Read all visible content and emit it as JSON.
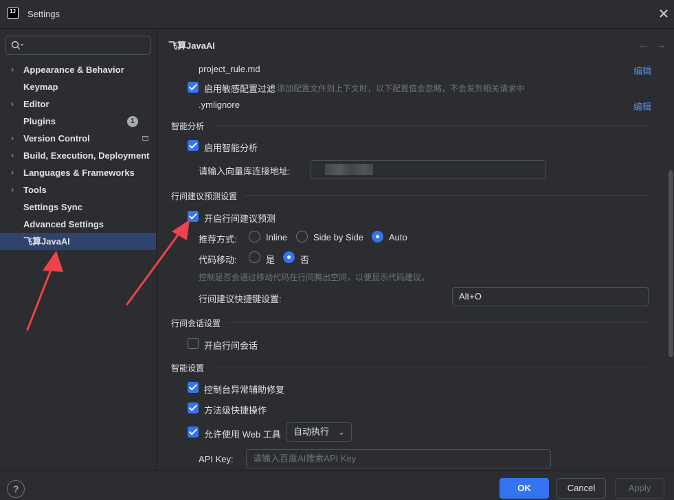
{
  "window": {
    "title": "Settings",
    "logo_text": "IJ",
    "close_icon": "close-icon"
  },
  "sidebar": {
    "search_placeholder": "",
    "items": [
      {
        "label": "Appearance & Behavior",
        "expandable": true
      },
      {
        "label": "Keymap",
        "expandable": false
      },
      {
        "label": "Editor",
        "expandable": true
      },
      {
        "label": "Plugins",
        "expandable": false,
        "badge": "1"
      },
      {
        "label": "Version Control",
        "expandable": true
      },
      {
        "label": "Build, Execution, Deployment",
        "expandable": true
      },
      {
        "label": "Languages & Frameworks",
        "expandable": true
      },
      {
        "label": "Tools",
        "expandable": true
      },
      {
        "label": "Settings Sync",
        "expandable": false
      },
      {
        "label": "Advanced Settings",
        "expandable": false
      },
      {
        "label": "飞算JavaAI",
        "expandable": false,
        "active": true
      }
    ]
  },
  "main": {
    "title": "飞算JavaAI",
    "rows": {
      "project_rule": {
        "label": "project_rule.md",
        "edit": "编辑"
      },
      "sensitive": {
        "label": "启用敏感配置过滤",
        "hint": "添加配置文件到上下文时，以下配置值会忽略，不会发到相关请求中",
        "checked": true
      },
      "ymlignore": {
        "label": ".ymlignore",
        "edit": "编辑"
      }
    },
    "smart_analysis": {
      "heading": "智能分析",
      "enable_label": "启用智能分析",
      "enable_checked": true,
      "vector_label": "请输入向量库连接地址:"
    },
    "inline_suggest": {
      "heading": "行间建议预测设置",
      "enable_label": "开启行间建议预测",
      "enable_checked": true,
      "mode_label": "推荐方式:",
      "modes": [
        "Inline",
        "Side by Side",
        "Auto"
      ],
      "mode_selected": "Auto",
      "move_label": "代码移动:",
      "move_options": [
        "是",
        "否"
      ],
      "move_selected": "否",
      "move_hint": "控制是否会通过移动代码在行间腾出空间，以便显示代码建议。",
      "shortcut_label": "行间建议快捷键设置:",
      "shortcut_value": "Alt+O"
    },
    "inline_chat": {
      "heading": "行间会话设置",
      "enable_label": "开启行间会话",
      "enable_checked": false
    },
    "smart_settings": {
      "heading": "智能设置",
      "console_fix_label": "控制台异常辅助修复",
      "console_fix_checked": true,
      "method_shortcut_label": "方法级快捷操作",
      "method_shortcut_checked": true,
      "web_tool_label": "允许使用 Web 工具",
      "web_tool_checked": true,
      "web_tool_mode": "自动执行",
      "api_key_label": "API Key:",
      "api_key_placeholder": "请输入百度AI搜索API Key"
    }
  },
  "footer": {
    "help": "?",
    "ok": "OK",
    "cancel": "Cancel",
    "apply": "Apply"
  },
  "colors": {
    "accent": "#3574f0",
    "link": "#548af7",
    "annotation_arrow": "#f0424c"
  }
}
